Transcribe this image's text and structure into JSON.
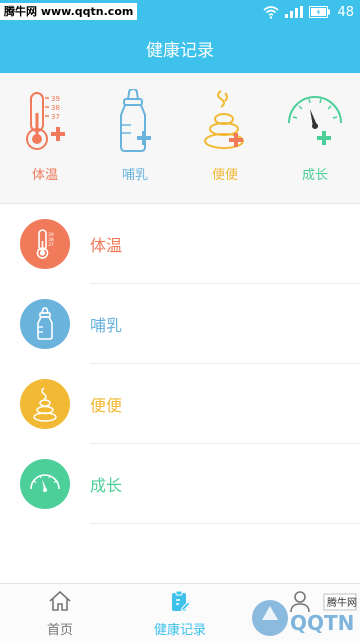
{
  "status": {
    "watermark": "腾牛网 www.qqtn.com",
    "battery": "48"
  },
  "header": {
    "title": "健康记录"
  },
  "quick": [
    {
      "label": "体温",
      "color": "#f07a5a",
      "icon": "thermometer-add-icon"
    },
    {
      "label": "哺乳",
      "color": "#6ab3dd",
      "icon": "baby-bottle-add-icon"
    },
    {
      "label": "便便",
      "color": "#f2b935",
      "icon": "poop-add-icon"
    },
    {
      "label": "成长",
      "color": "#4ccf98",
      "icon": "gauge-add-icon"
    }
  ],
  "records": [
    {
      "label": "体温",
      "color": "#f07a5a",
      "icon": "thermometer-icon"
    },
    {
      "label": "哺乳",
      "color": "#6ab3dd",
      "icon": "baby-bottle-icon"
    },
    {
      "label": "便便",
      "color": "#f2b935",
      "icon": "poop-icon"
    },
    {
      "label": "成长",
      "color": "#4ccf98",
      "icon": "gauge-icon"
    }
  ],
  "tabs": [
    {
      "label": "首页",
      "active": false
    },
    {
      "label": "健康记录",
      "active": true
    },
    {
      "label": "",
      "active": false
    }
  ],
  "corner_watermark": {
    "brand": "QQTN",
    "sub": "腾牛网"
  }
}
